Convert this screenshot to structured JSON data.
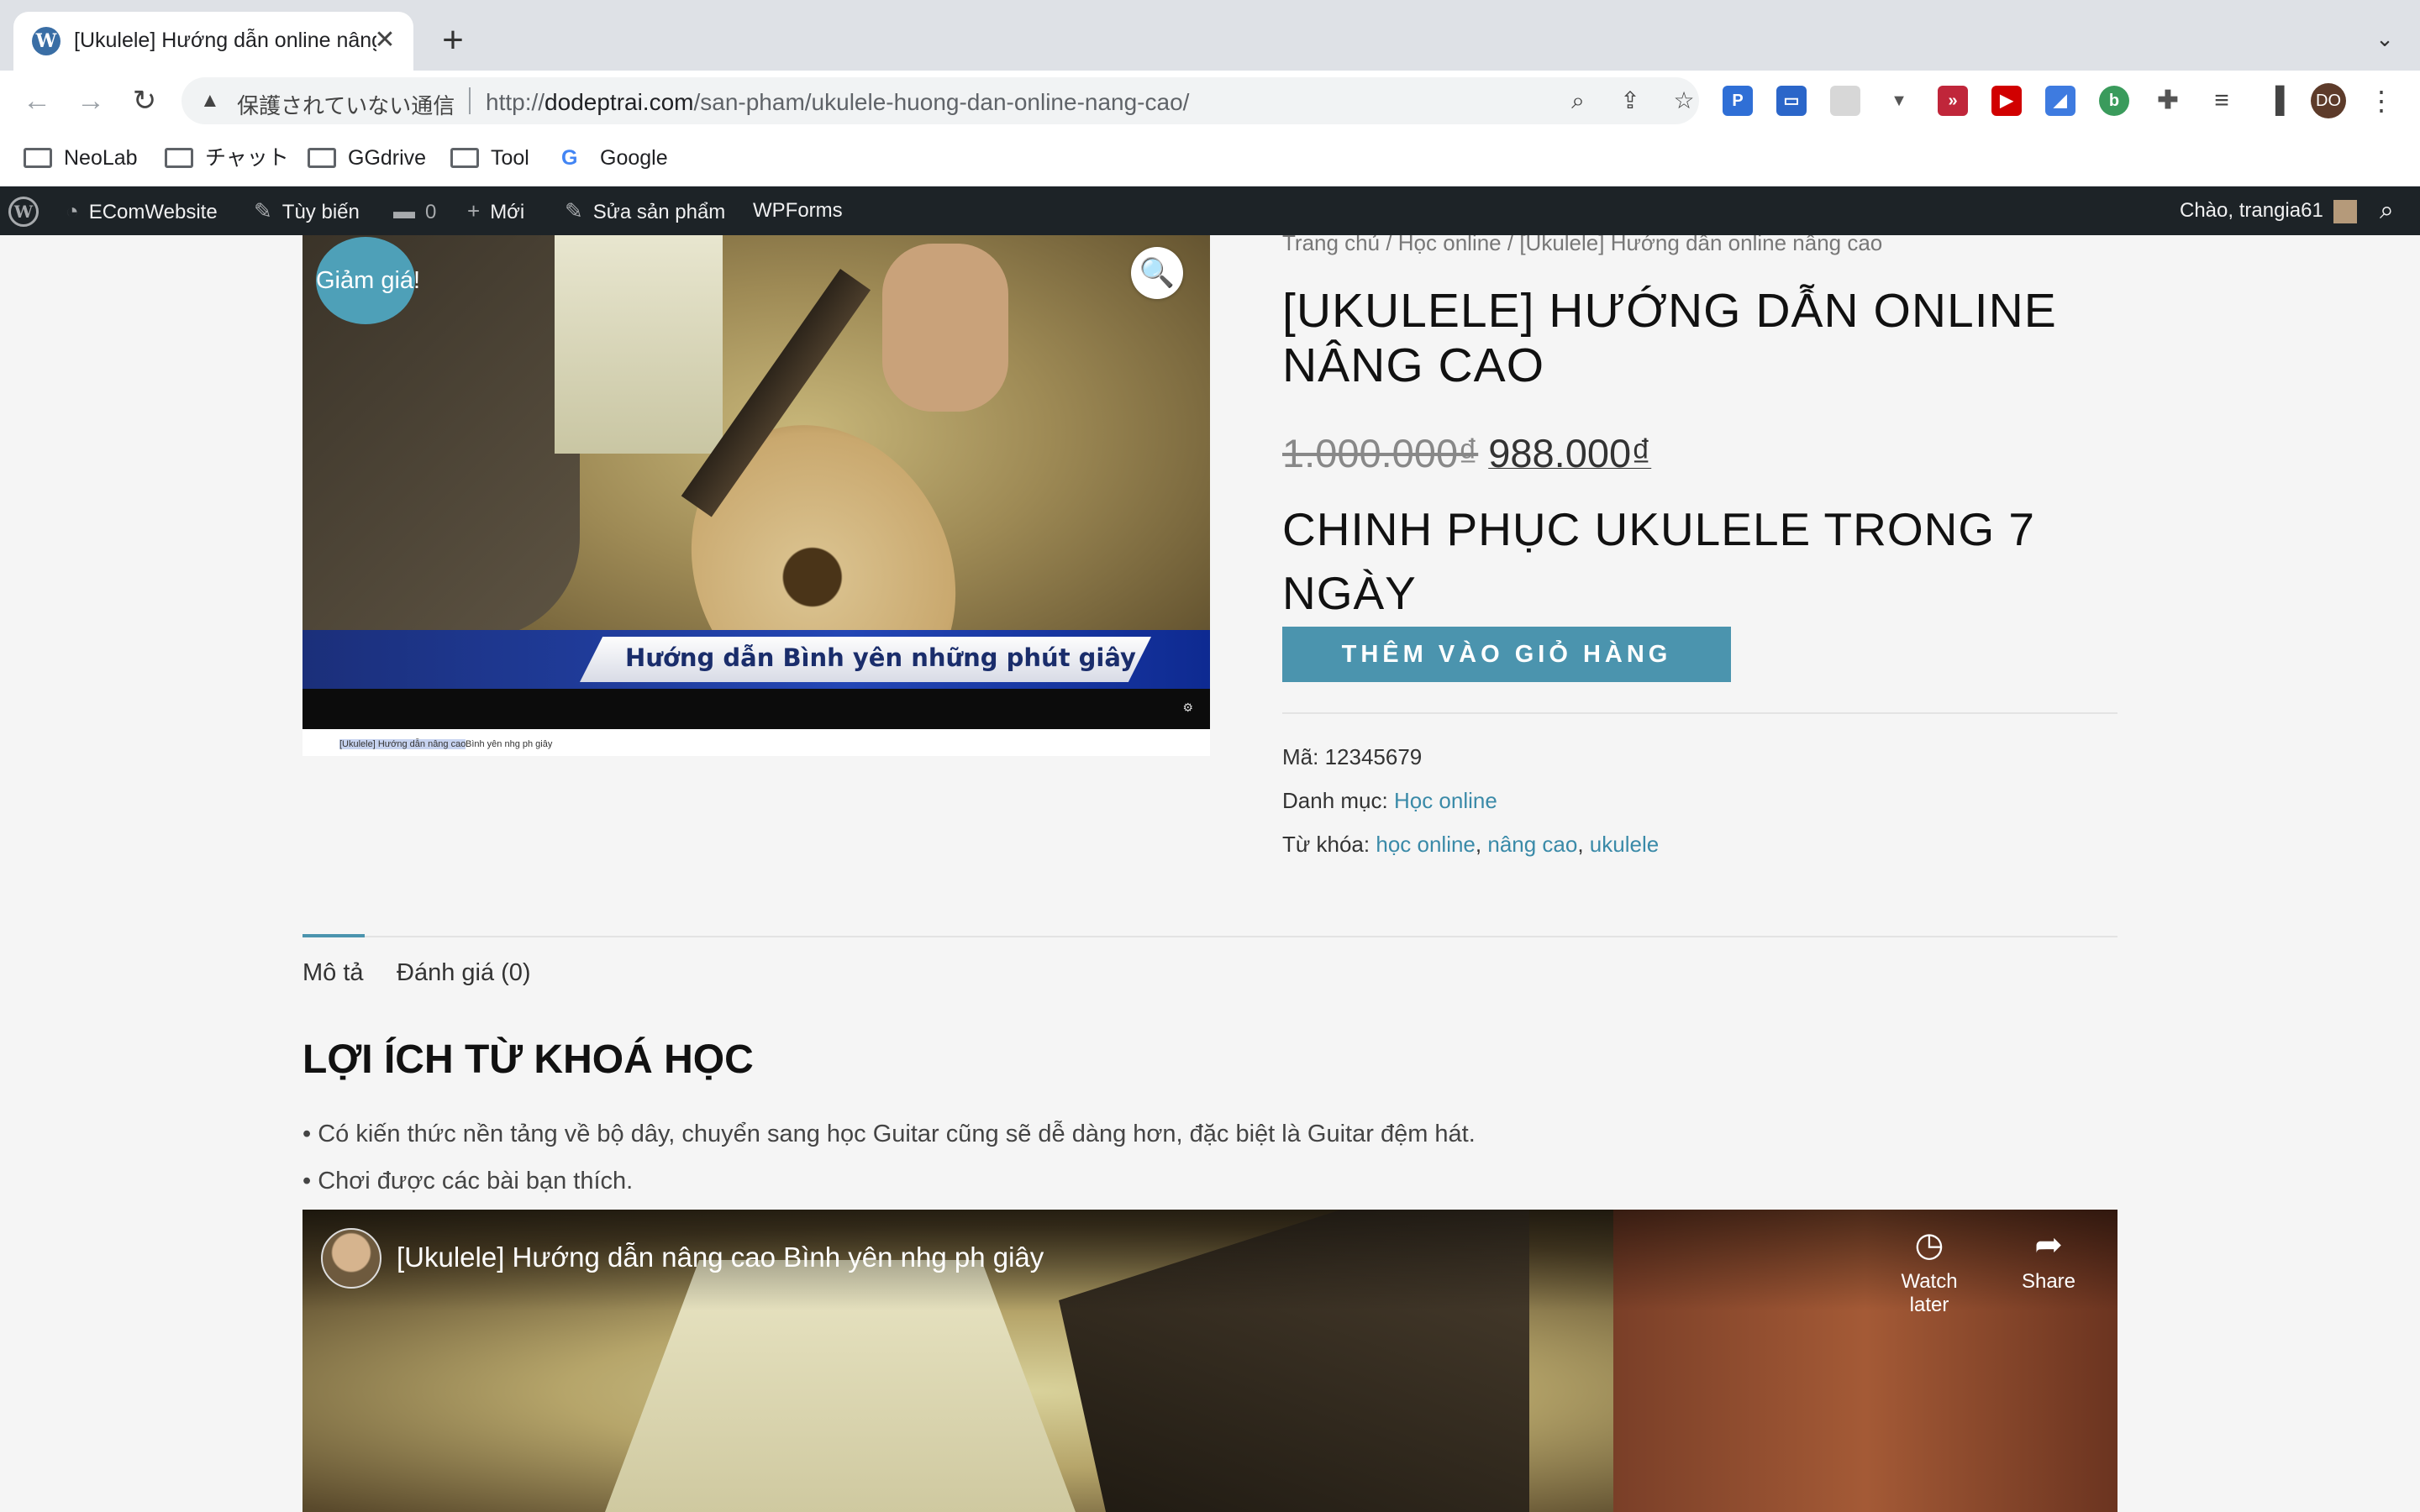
{
  "browser": {
    "tab_title": "[Ukulele] Hướng dẫn online nâng cao",
    "new_tab_symbol": "+",
    "security_label": "保護されていない通信",
    "url_scheme": "http://",
    "url_host": "dodeptrai.com",
    "url_path": "/san-pham/ukulele-huong-dan-online-nang-cao/",
    "profile_initials": "DO",
    "icons": [
      "back-arrow-icon",
      "forward-arrow-icon",
      "reload-icon",
      "warning-icon",
      "zoom-icon",
      "share-icon",
      "star-icon",
      "extensions-icon",
      "reading-list-icon",
      "side-panel-icon",
      "more-vert-icon"
    ]
  },
  "bookmarks": [
    {
      "label": "NeoLab",
      "icon": "folder-icon"
    },
    {
      "label": "チャット",
      "icon": "folder-icon"
    },
    {
      "label": "GGdrive",
      "icon": "folder-icon"
    },
    {
      "label": "Tool",
      "icon": "folder-icon"
    },
    {
      "label": "Google",
      "icon": "google-icon"
    }
  ],
  "adminbar": {
    "site_name": "EComWebsite",
    "customize": "Tùy biến",
    "comments_count": "0",
    "new": "Mới",
    "edit_product": "Sửa sản phẩm",
    "wpforms": "WPForms",
    "greeting": "Chào, trangia61"
  },
  "product": {
    "sale_badge": "Giảm giá!",
    "image_caption": "Hướng dẫn Bình yên những phút giây",
    "thumb_caption_selected": "[Ukulele] Hướng dẫn nâng cao",
    "thumb_caption_rest": "Bình yên nhg ph giây",
    "breadcrumb": {
      "home": "Trang chủ",
      "sep": " / ",
      "category": "Học online",
      "current": "[Ukulele] Hướng dẫn online nâng cao"
    },
    "title": "[UKULELE] HƯỚNG DẪN ONLINE NÂNG CAO",
    "price_old": "1.000.000₫",
    "price_new": "988.000₫",
    "short_description": "CHINH PHỤC UKULELE TRONG 7 NGÀY",
    "add_to_cart": "THÊM VÀO GIỎ HÀNG",
    "sku_label": "Mã:",
    "sku": "12345679",
    "category_label": "Danh mục:",
    "category": "Học online",
    "tags_label": "Từ khóa:",
    "tags": [
      "học online",
      "nâng cao",
      "ukulele"
    ],
    "tag_sep": ", "
  },
  "tabs": {
    "description": "Mô tả",
    "reviews": "Đánh giá (0)"
  },
  "description": {
    "heading": "LỢI ÍCH TỪ KHOÁ HỌC",
    "benefits": [
      "• Có kiến thức nền tảng về bộ dây, chuyển sang học Guitar cũng sẽ dễ dàng hơn, đặc biệt là Guitar đệm hát.",
      "• Chơi được các bài bạn thích."
    ]
  },
  "video": {
    "title": "[Ukulele] Hướng dẫn nâng cao Bình yên nhg ph giây",
    "watch_later": "Watch later",
    "share": "Share"
  },
  "colors": {
    "accent": "#4b94ae",
    "link": "#3a8aa8",
    "adminbar": "#1d2327",
    "page_bg": "#f5f5f5"
  }
}
